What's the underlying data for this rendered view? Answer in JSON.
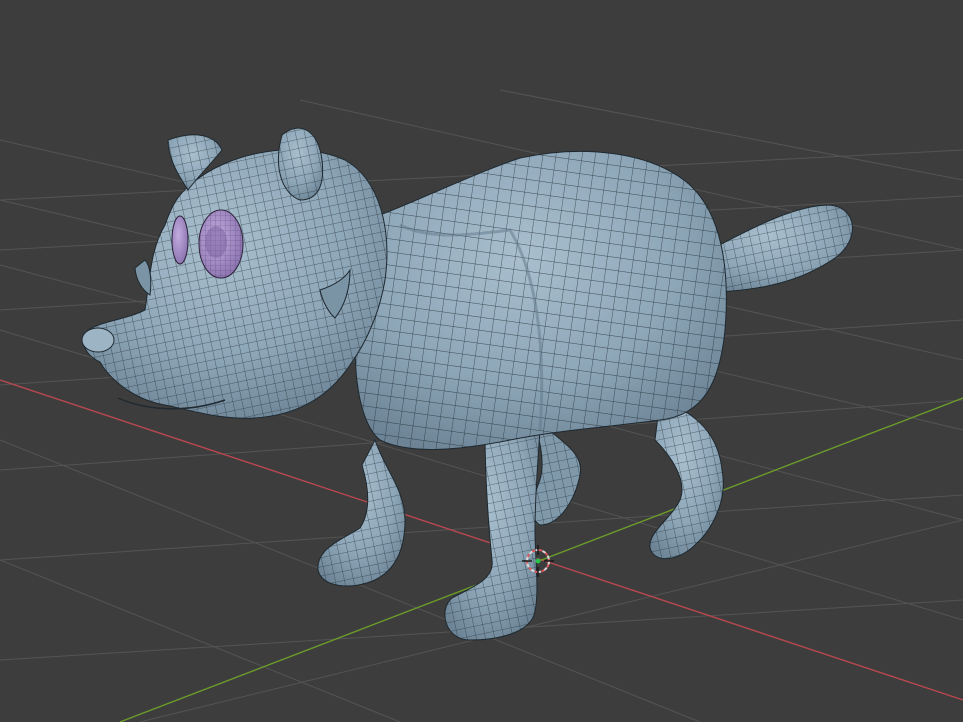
{
  "viewport": {
    "background": "#3d3d3d",
    "grid_color": "#545454",
    "x_axis_color": "#b8484f",
    "y_axis_color": "#6b9b2a"
  },
  "model": {
    "name": "wolf-mesh",
    "body_color": "#8da6b8",
    "shadow_color": "#6f8799",
    "wire_color": "#1e2930",
    "eye_color": "#a68ec7"
  },
  "cursor": {
    "icon": "3d-cursor-icon",
    "ring_color": "#d9d9d9",
    "accent_color": "#e0555a",
    "origin_color": "#26c24b"
  }
}
